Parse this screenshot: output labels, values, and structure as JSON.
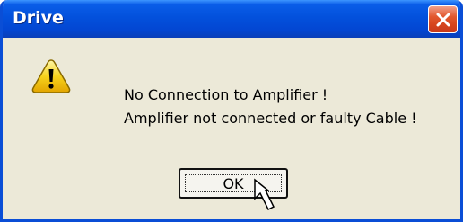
{
  "window": {
    "title": "Drive",
    "close_label": "×"
  },
  "message": {
    "line1": "No Connection to Amplifier !",
    "line2": "Amplifier not connected or faulty Cable !"
  },
  "buttons": {
    "ok_label": "OK"
  },
  "icons": {
    "status_icon": "warning-icon",
    "cursor": "mouse-pointer-icon"
  },
  "colors": {
    "titlebar": "#0351dc",
    "close_button": "#d6451d",
    "dialog_background": "#ece9d8",
    "warning_fill": "#f6d21c"
  }
}
